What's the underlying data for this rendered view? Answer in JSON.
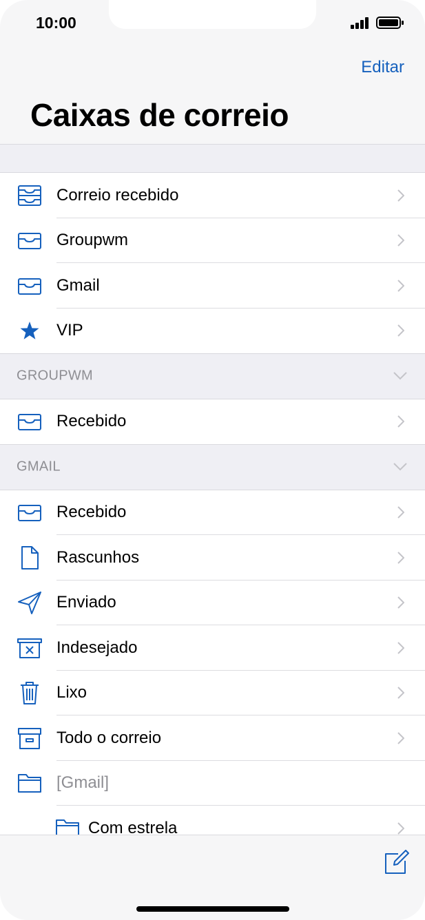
{
  "status_bar": {
    "time": "10:00"
  },
  "nav": {
    "edit_label": "Editar",
    "title": "Caixas de correio"
  },
  "colors": {
    "accent": "#1560bd",
    "section_bg": "#efeff4",
    "secondary_text": "#8e8e93"
  },
  "mailboxes": [
    {
      "label": "Correio recebido",
      "icon": "all-inboxes-icon"
    },
    {
      "label": "Groupwm",
      "icon": "inbox-icon"
    },
    {
      "label": "Gmail",
      "icon": "inbox-icon"
    },
    {
      "label": "VIP",
      "icon": "star-icon"
    }
  ],
  "sections": [
    {
      "header": "GROUPWM",
      "items": [
        {
          "label": "Recebido",
          "icon": "inbox-icon"
        }
      ]
    },
    {
      "header": "GMAIL",
      "items": [
        {
          "label": "Recebido",
          "icon": "inbox-icon"
        },
        {
          "label": "Rascunhos",
          "icon": "document-icon"
        },
        {
          "label": "Enviado",
          "icon": "paper-plane-icon"
        },
        {
          "label": "Indesejado",
          "icon": "junk-icon"
        },
        {
          "label": "Lixo",
          "icon": "trash-icon"
        },
        {
          "label": "Todo o correio",
          "icon": "archive-icon"
        },
        {
          "label": "[Gmail]",
          "icon": "folder-icon"
        },
        {
          "label": "Com estrela",
          "icon": "folder-icon"
        }
      ]
    }
  ],
  "toolbar": {
    "compose_icon": "compose-icon"
  }
}
